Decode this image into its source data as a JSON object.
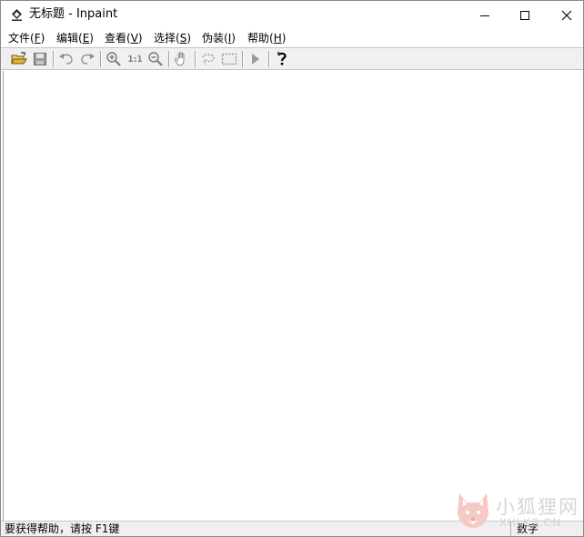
{
  "window": {
    "title": "无标题 - Inpaint"
  },
  "menu": [
    {
      "label": "文件(",
      "key": "F",
      "tail": ")"
    },
    {
      "label": "编辑(",
      "key": "E",
      "tail": ")"
    },
    {
      "label": "查看(",
      "key": "V",
      "tail": ")"
    },
    {
      "label": "选择(",
      "key": "S",
      "tail": ")"
    },
    {
      "label": "伪装(",
      "key": "I",
      "tail": ")"
    },
    {
      "label": "帮助(",
      "key": "H",
      "tail": ")"
    }
  ],
  "toolbar": {
    "actual_size_label": "1:1",
    "icons": [
      "open-folder-icon",
      "save-icon",
      "undo-icon",
      "redo-icon",
      "zoom-in-icon",
      "actual-size-icon",
      "zoom-out-icon",
      "hand-pan-icon",
      "lasso-select-icon",
      "rect-select-icon",
      "run-icon",
      "help-icon"
    ]
  },
  "status": {
    "hint": "要获得帮助，请按 F1键",
    "num": "数字"
  },
  "watermark": {
    "cn": "小狐狸网",
    "en": "XHLKS.CN"
  },
  "colors": {
    "toolbar_bg": "#f0f0f0",
    "folder_yellow": "#e8b33a",
    "icon_gray": "#7a7a7a"
  }
}
